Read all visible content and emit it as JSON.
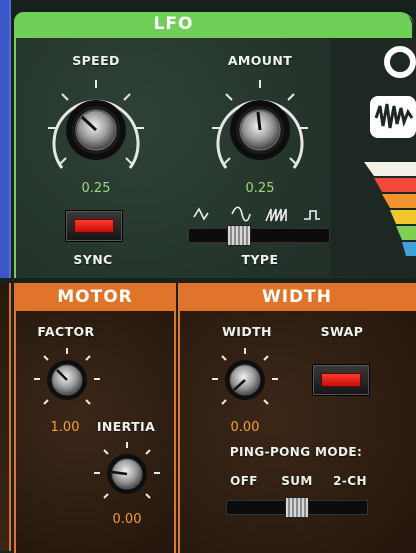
{
  "lfo": {
    "title": "LFO",
    "speed": {
      "label": "SPEED",
      "value": "0.25",
      "level": 0.32
    },
    "amount": {
      "label": "AMOUNT",
      "value": "0.25",
      "level": 0.45
    },
    "sync_label": "SYNC",
    "type_label": "TYPE",
    "type_icons": [
      "sine-wave-icon",
      "triangle-wave-icon",
      "sawtooth-wave-icon",
      "square-wave-icon"
    ],
    "type_selected_index": 1
  },
  "motor": {
    "title": "MOTOR",
    "factor": {
      "label": "FACTOR",
      "value": "1.00",
      "level": 0.3
    },
    "inertia": {
      "label": "INERTIA",
      "value": "0.00",
      "level": 0.0
    }
  },
  "width": {
    "title": "WIDTH",
    "width_knob": {
      "label": "WIDTH",
      "value": "0.00",
      "level": 0.0
    },
    "swap_label": "SWAP",
    "ping_pong_label": "PING-PONG MODE:",
    "modes": [
      "OFF",
      "SUM",
      "2-CH"
    ],
    "mode_selected_index": 1
  },
  "colors": {
    "lfo_accent": "#6fcf58",
    "value_green": "#9bd97a",
    "value_orange": "#f2a033",
    "panel_accent_orange": "#e0742a",
    "switch_red": "#e3281c"
  }
}
